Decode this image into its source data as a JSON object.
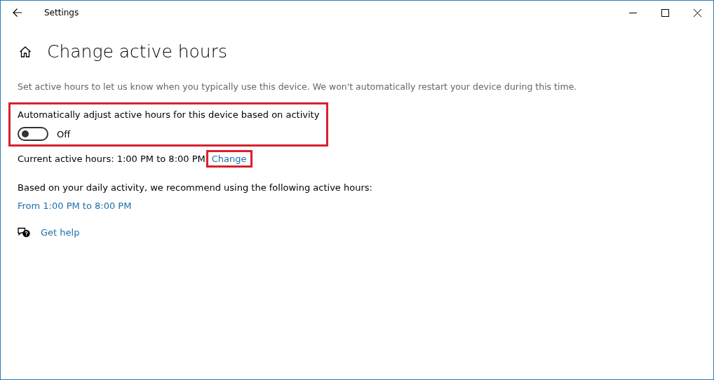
{
  "window": {
    "title": "Settings"
  },
  "page": {
    "title": "Change active hours",
    "description": "Set active hours to let us know when you typically use this device. We won't automatically restart your device during this time."
  },
  "auto_adjust": {
    "label": "Automatically adjust active hours for this device based on activity",
    "on": false,
    "state_label": "Off",
    "highlighted": true
  },
  "current_hours": {
    "text": "Current active hours: 1:00 PM to 8:00 PM",
    "link": "Change",
    "highlighted": true
  },
  "recommendation": {
    "text": "Based on your daily activity, we recommend using the following active hours:",
    "link": "From 1:00 PM to 8:00 PM"
  },
  "help": {
    "link": "Get help"
  }
}
